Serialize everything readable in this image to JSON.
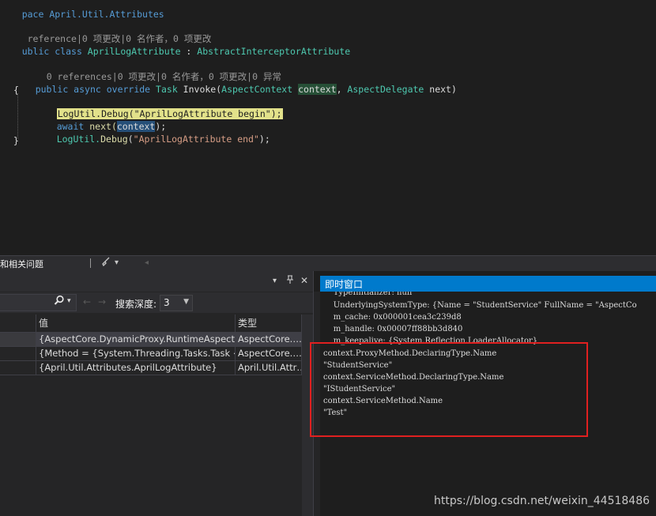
{
  "editor": {
    "line_namespace": "pace April.Util.Attributes",
    "lens_class": " reference|0 项更改|0 名作者，0 项更改",
    "class_kw1": "ublic",
    "class_kw2": " class ",
    "class_name": "AprilLogAttribute",
    "class_colon": " : ",
    "class_base": "AbstractInterceptorAttribute",
    "lens_method": "0 references|0 项更改|0 名作者，0 项更改|0 异常",
    "m_public": "public",
    "m_async": " async",
    "m_override": " override ",
    "m_task": "Task",
    "m_invoke": " Invoke(",
    "m_ctxtype": "AspectContext",
    "m_sp": " ",
    "m_ctx": "context",
    "m_comma": ", ",
    "m_deltype": "AspectDelegate",
    "m_next": " next)",
    "brace_open": "{",
    "l1_hl": "LogUtil.Debug(\"AprilLogAttribute begin\");",
    "l2_await": "await",
    "l2_next": " next(",
    "l2_ctx": "context",
    "l2_end": ");",
    "l3_obj": "LogUtil.",
    "l3_fn": "Debug",
    "l3_p": "(",
    "l3_str": "\"AprilLogAttribute end\"",
    "l3_end": ");",
    "brace_close": "}"
  },
  "sep_bar": {
    "label": "和相关问题",
    "brush_icon": "broom-icon",
    "caret": "▾",
    "arrow": "◂"
  },
  "locals": {
    "pin": "▾",
    "pushpin": "ᛘ",
    "close": "✕",
    "search_caret": "▾",
    "back": "←",
    "forward": "→",
    "depth_label": "搜索深度:",
    "depth_value": "3",
    "columns": [
      "",
      "值",
      "类型"
    ],
    "rows": [
      {
        "name": "",
        "value": "{AspectCore.DynamicProxy.RuntimeAspectC…",
        "type": "AspectCore.…"
      },
      {
        "name": "",
        "value": "{Method = {System.Threading.Tasks.Task <C…",
        "type": "AspectCore.…"
      },
      {
        "name": "",
        "value": "{April.Util.Attributes.AprilLogAttribute}",
        "type": "April.Util.Attr…"
      }
    ]
  },
  "immediate": {
    "title": "即时窗口",
    "lines": [
      "    TypeInitializer: null",
      "    UnderlyingSystemType: {Name = \"StudentService\" FullName = \"AspectCo",
      "    m_cache: 0x000001cea3c239d8",
      "    m_handle: 0x00007ff88bb3d840",
      "    m_keepalive: {System.Reflection.LoaderAllocator}",
      "context.ProxyMethod.DeclaringType.Name",
      "\"StudentService\"",
      "context.ServiceMethod.DeclaringType.Name",
      "\"IStudentService\"",
      "context.ServiceMethod.Name",
      "\"Test\""
    ]
  },
  "watermark": "https://blog.csdn.net/weixin_44518486",
  "colors": {
    "accent": "#007acc",
    "highlight_box": "#e02020"
  }
}
